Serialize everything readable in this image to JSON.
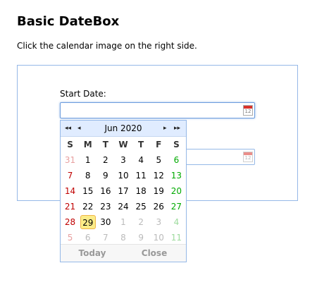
{
  "page": {
    "title": "Basic DateBox",
    "description": "Click the calendar image on the right side."
  },
  "form": {
    "start_label": "Start Date:",
    "start_value": "",
    "end_value": "",
    "calendar_icon_number": "12"
  },
  "calendar": {
    "month_label": "Jun 2020",
    "weekdays": [
      "S",
      "M",
      "T",
      "W",
      "T",
      "F",
      "S"
    ],
    "weeks": [
      [
        "31",
        "1",
        "2",
        "3",
        "4",
        "5",
        "6"
      ],
      [
        "7",
        "8",
        "9",
        "10",
        "11",
        "12",
        "13"
      ],
      [
        "14",
        "15",
        "16",
        "17",
        "18",
        "19",
        "20"
      ],
      [
        "21",
        "22",
        "23",
        "24",
        "25",
        "26",
        "27"
      ],
      [
        "28",
        "29",
        "30",
        "1",
        "2",
        "3",
        "4"
      ],
      [
        "5",
        "6",
        "7",
        "8",
        "9",
        "10",
        "11"
      ]
    ],
    "other_month": [
      [
        0,
        0
      ],
      [
        4,
        3
      ],
      [
        4,
        4
      ],
      [
        4,
        5
      ],
      [
        4,
        6
      ],
      [
        5,
        0
      ],
      [
        5,
        1
      ],
      [
        5,
        2
      ],
      [
        5,
        3
      ],
      [
        5,
        4
      ],
      [
        5,
        5
      ],
      [
        5,
        6
      ]
    ],
    "selected": [
      4,
      1
    ],
    "nav": {
      "prev_year": "◂◂",
      "prev_month": "◂",
      "next_month": "▸",
      "next_year": "▸▸"
    },
    "today_label": "Today",
    "close_label": "Close"
  },
  "colors": {
    "border": "#95b8e7",
    "header_bg": "#e0ecff",
    "sunday": "#c00000",
    "saturday": "#00aa00",
    "selected_bg": "#fbec88",
    "selected_border": "#f0b447"
  }
}
